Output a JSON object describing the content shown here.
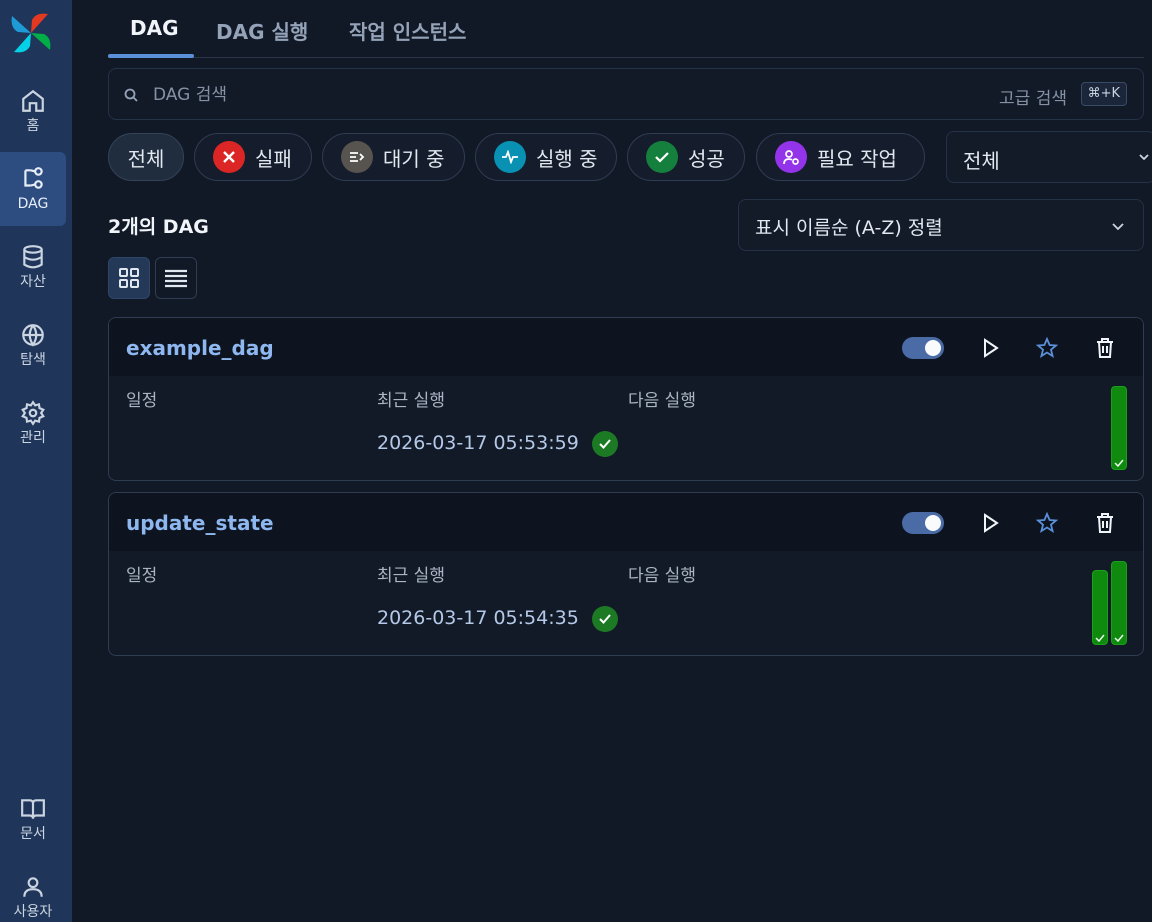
{
  "sidebar": {
    "items": [
      {
        "label": "홈",
        "icon": "home-icon"
      },
      {
        "label": "DAG",
        "icon": "dag-icon",
        "active": true
      },
      {
        "label": "자산",
        "icon": "database-icon"
      },
      {
        "label": "탐색",
        "icon": "globe-icon"
      },
      {
        "label": "관리",
        "icon": "gear-icon"
      },
      {
        "label": "문서",
        "icon": "book-icon"
      },
      {
        "label": "사용자",
        "icon": "user-icon"
      }
    ]
  },
  "tabs": [
    {
      "label": "DAG",
      "active": true
    },
    {
      "label": "DAG 실행"
    },
    {
      "label": "작업 인스턴스"
    }
  ],
  "search": {
    "placeholder": "DAG 검색",
    "value": "",
    "advanced_label": "고급 검색",
    "shortcut": "⌘+K"
  },
  "filters": [
    {
      "label": "전체",
      "active": true
    },
    {
      "label": "실패",
      "icon": "x-icon",
      "color": "#dc2626"
    },
    {
      "label": "대기 중",
      "icon": "queue-icon",
      "color": "#57534e"
    },
    {
      "label": "실행 중",
      "icon": "activity-icon",
      "color": "#0891b2"
    },
    {
      "label": "성공",
      "icon": "check-icon",
      "color": "#15803d"
    },
    {
      "label": "필요 작업",
      "icon": "user-action-icon",
      "color": "#9333ea"
    }
  ],
  "state_select": {
    "value": "전체"
  },
  "dag_count": "2개의 DAG",
  "sort": {
    "value": "표시 이름순 (A-Z) 정렬"
  },
  "view_modes": {
    "active": "grid"
  },
  "columns": {
    "schedule": "일정",
    "latest_run": "최근 실행",
    "next_run": "다음 실행"
  },
  "dags": [
    {
      "dag_id": "example_dag",
      "enabled": true,
      "latest_run": "2026-03-17 05:53:59",
      "latest_run_state": "success",
      "recent_runs": [
        {
          "state": "success",
          "duration_ratio": 1.0
        }
      ]
    },
    {
      "dag_id": "update_state",
      "enabled": true,
      "latest_run": "2026-03-17 05:54:35",
      "latest_run_state": "success",
      "recent_runs": [
        {
          "state": "success",
          "duration_ratio": 0.89
        },
        {
          "state": "success",
          "duration_ratio": 1.0
        }
      ]
    }
  ],
  "colors": {
    "accent": "#5b8fd8",
    "success": "#0f8a0f",
    "link": "#8fb7ef"
  }
}
